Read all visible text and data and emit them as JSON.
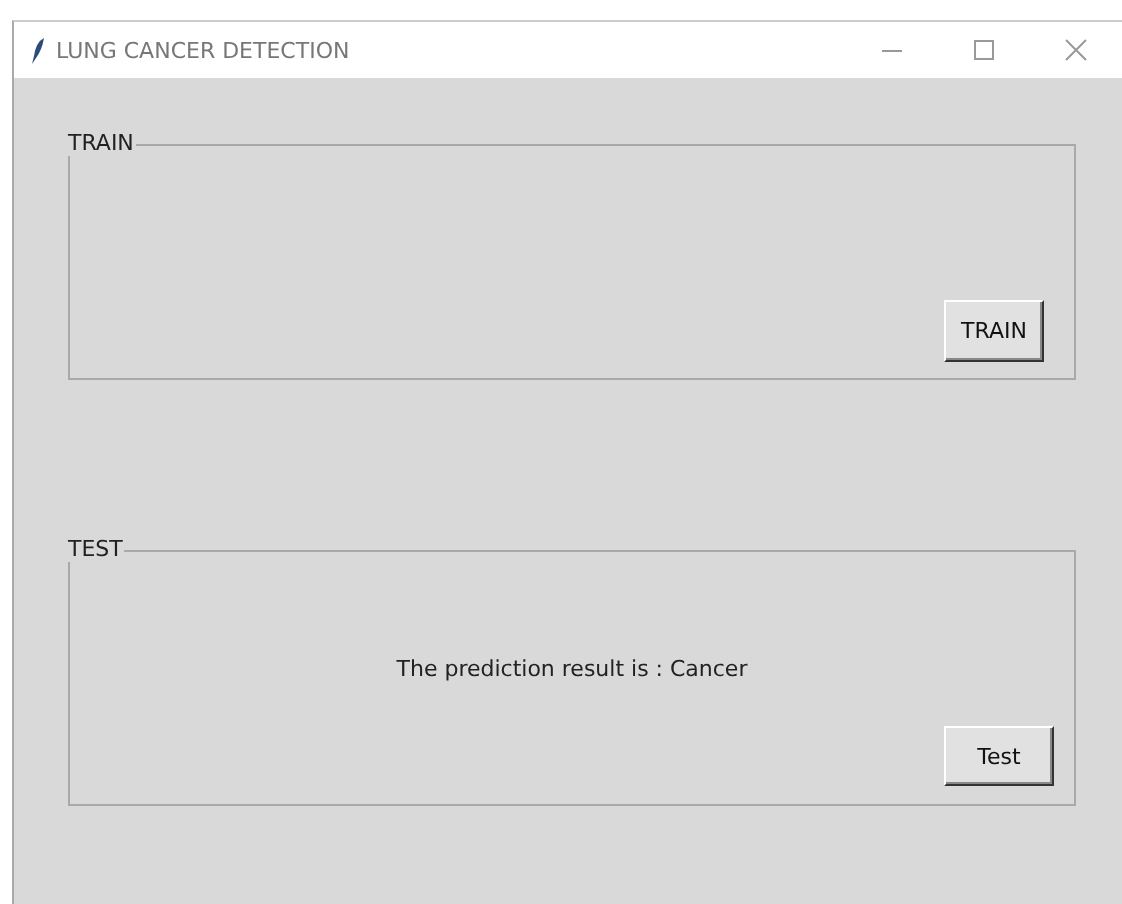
{
  "window": {
    "title": "LUNG CANCER DETECTION"
  },
  "frames": [
    {
      "legend": "TRAIN",
      "button": "TRAIN"
    },
    {
      "legend": "TEST",
      "message": "The prediction result is : Cancer",
      "button": "Test"
    }
  ]
}
